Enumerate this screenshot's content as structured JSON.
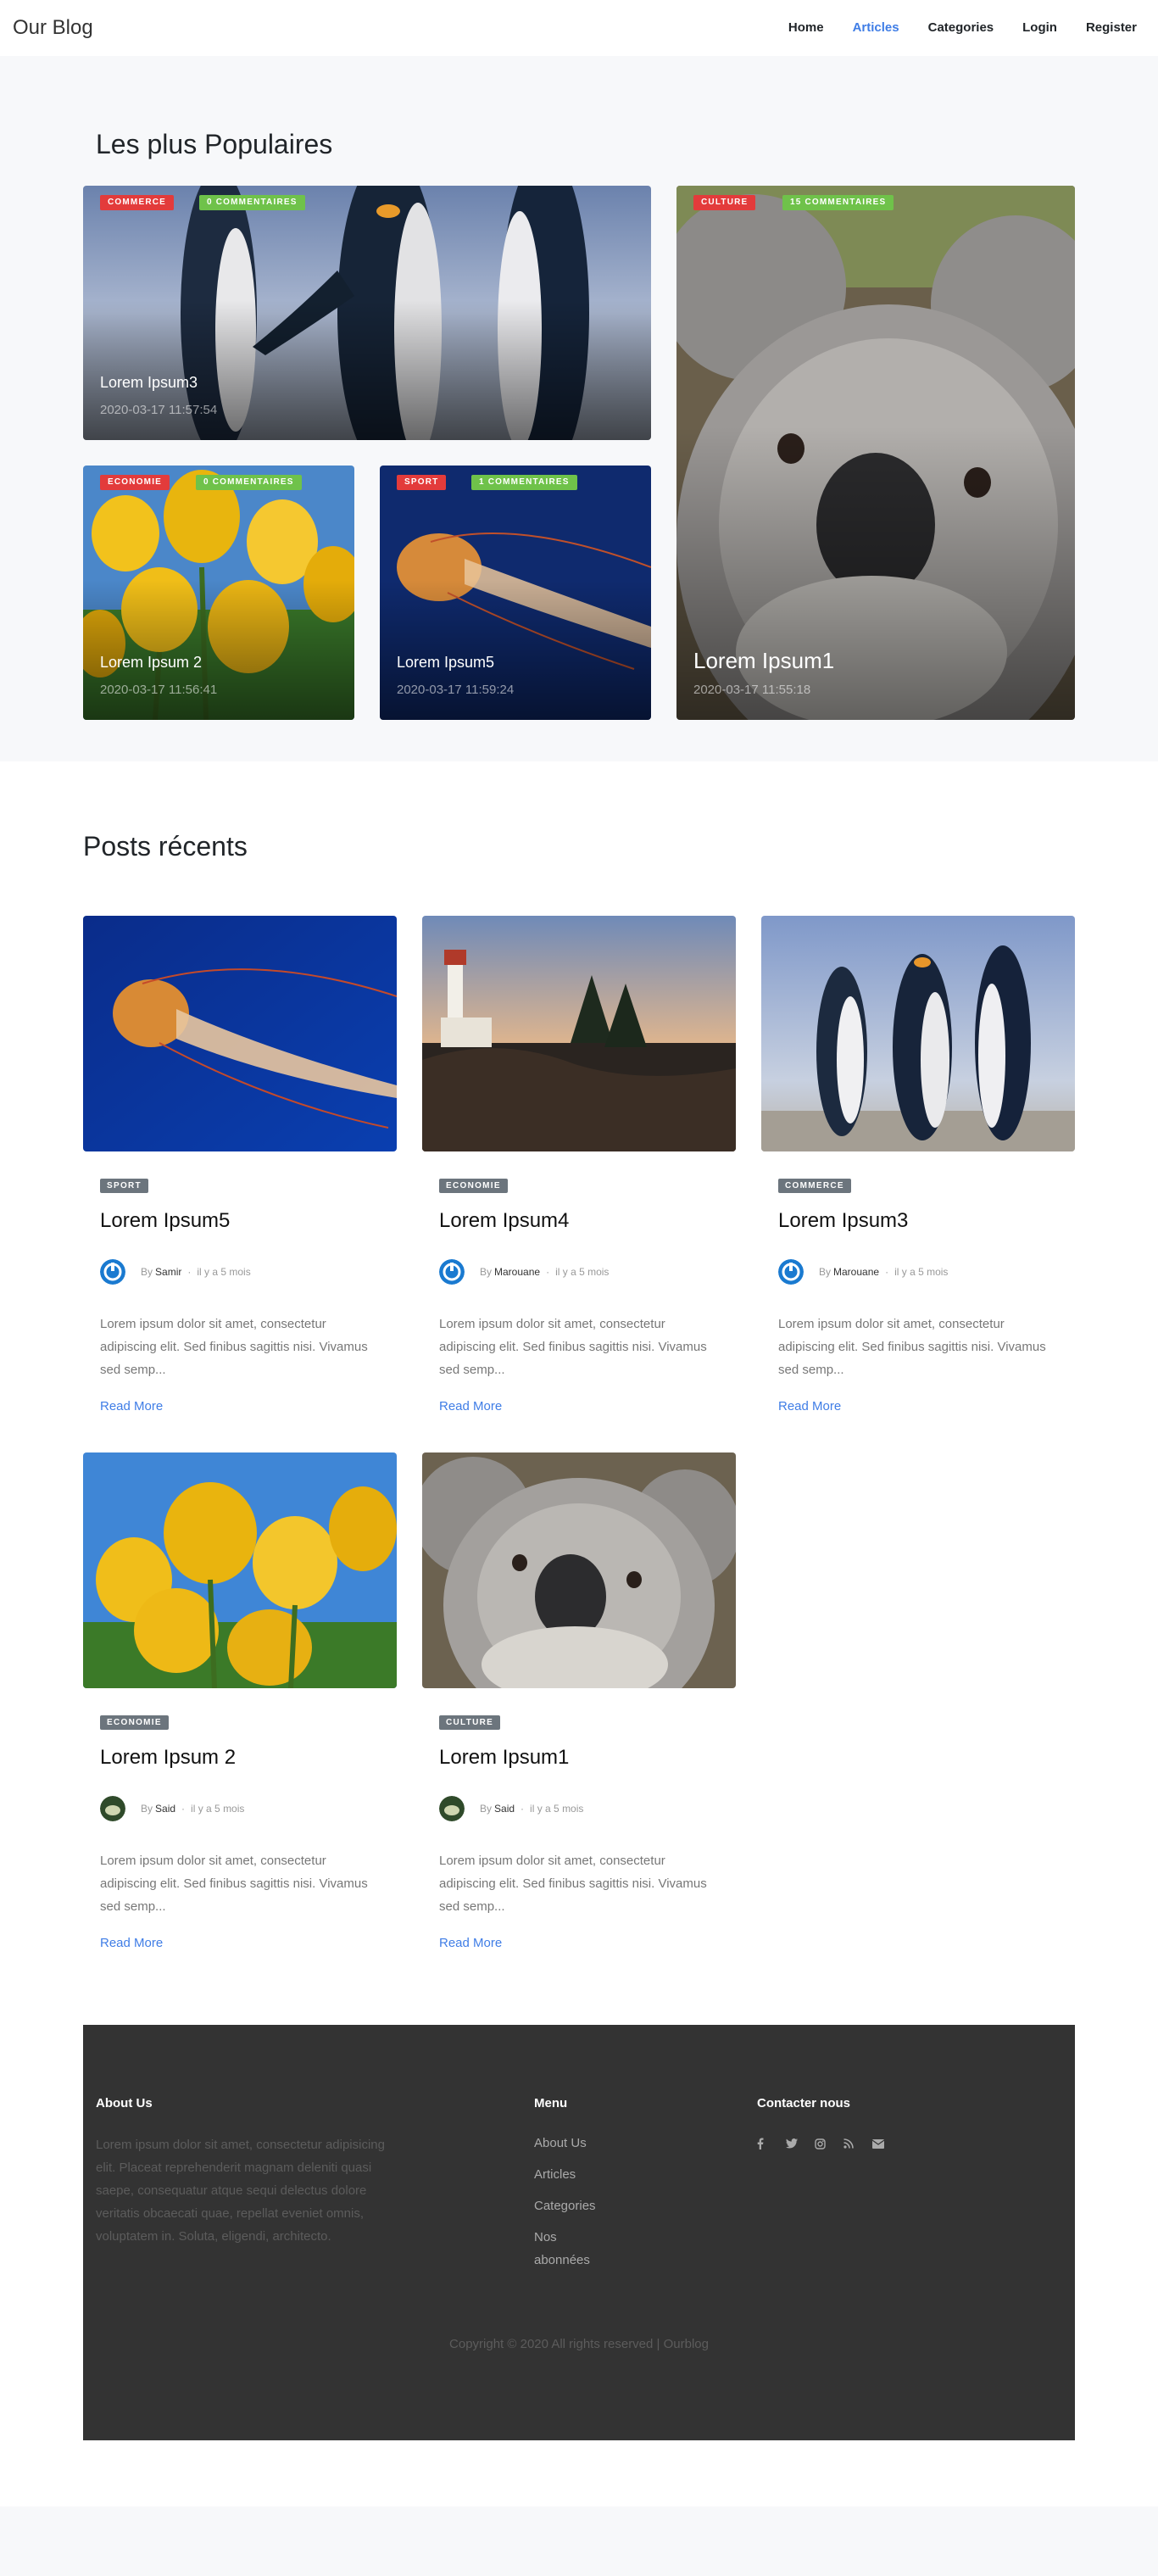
{
  "navbar": {
    "brand": "Our Blog",
    "links": [
      {
        "label": "Home",
        "active": false
      },
      {
        "label": "Articles",
        "active": true
      },
      {
        "label": "Categories",
        "active": false
      },
      {
        "label": "Login",
        "active": false
      },
      {
        "label": "Register",
        "active": false
      }
    ]
  },
  "popular": {
    "title": "Les plus Populaires",
    "cards": [
      {
        "category": "COMMERCE",
        "comments": "0 COMMENTAIRES",
        "title": "Lorem Ipsum3",
        "date": "2020-03-17 11:57:54",
        "image": "penguins"
      },
      {
        "category": "CULTURE",
        "comments": "15 COMMENTAIRES",
        "title": "Lorem Ipsum1",
        "date": "2020-03-17 11:55:18",
        "image": "koala"
      },
      {
        "category": "ECONOMIE",
        "comments": "0 COMMENTAIRES",
        "title": "Lorem Ipsum 2",
        "date": "2020-03-17 11:56:41",
        "image": "tulips"
      },
      {
        "category": "SPORT",
        "comments": "1 COMMENTAIRES",
        "title": "Lorem Ipsum5",
        "date": "2020-03-17 11:59:24",
        "image": "jellyfish"
      }
    ]
  },
  "recent": {
    "title": "Posts récents",
    "posts": [
      {
        "category": "SPORT",
        "title": "Lorem Ipsum5",
        "by": "By",
        "author": "Samir",
        "time": "il y a 5 mois",
        "excerpt": "Lorem ipsum dolor sit amet, consectetur adipiscing elit. Sed finibus sagittis nisi. Vivamus sed semp...",
        "read_more": "Read More",
        "image": "jellyfish",
        "avatar": "power-avatar"
      },
      {
        "category": "ECONOMIE",
        "title": "Lorem Ipsum4",
        "by": "By",
        "author": "Marouane",
        "time": "il y a 5 mois",
        "excerpt": "Lorem ipsum dolor sit amet, consectetur adipiscing elit. Sed finibus sagittis nisi. Vivamus sed semp...",
        "read_more": "Read More",
        "image": "lighthouse",
        "avatar": "power-avatar"
      },
      {
        "category": "COMMERCE",
        "title": "Lorem Ipsum3",
        "by": "By",
        "author": "Marouane",
        "time": "il y a 5 mois",
        "excerpt": "Lorem ipsum dolor sit amet, consectetur adipiscing elit. Sed finibus sagittis nisi. Vivamus sed semp...",
        "read_more": "Read More",
        "image": "penguins",
        "avatar": "power-avatar"
      },
      {
        "category": "ECONOMIE",
        "title": "Lorem Ipsum 2",
        "by": "By",
        "author": "Said",
        "time": "il y a 5 mois",
        "excerpt": "Lorem ipsum dolor sit amet, consectetur adipiscing elit. Sed finibus sagittis nisi. Vivamus sed semp...",
        "read_more": "Read More",
        "image": "tulips",
        "avatar": "photo-avatar"
      },
      {
        "category": "CULTURE",
        "title": "Lorem Ipsum1",
        "by": "By",
        "author": "Said",
        "time": "il y a 5 mois",
        "excerpt": "Lorem ipsum dolor sit amet, consectetur adipiscing elit. Sed finibus sagittis nisi. Vivamus sed semp...",
        "read_more": "Read More",
        "image": "koala",
        "avatar": "photo-avatar"
      }
    ]
  },
  "footer": {
    "about_title": "About Us",
    "about_text": "Lorem ipsum dolor sit amet, consectetur adipisicing elit. Placeat reprehenderit magnam deleniti quasi saepe, consequatur atque sequi delectus dolore veritatis obcaecati quae, repellat eveniet omnis, voluptatem in. Soluta, eligendi, architecto.",
    "menu_title": "Menu",
    "menu_items": [
      "About Us",
      "Articles",
      "Categories",
      "Nos abonnées"
    ],
    "contact_title": "Contacter nous",
    "social_icons": [
      "facebook-icon",
      "twitter-icon",
      "instagram-icon",
      "rss-icon",
      "envelope-icon"
    ],
    "copyright": "Copyright © 2020 All rights reserved | Ourblog"
  },
  "colors": {
    "accent": "#3f7de6",
    "category_pill": "#e33b3b",
    "comments_pill": "#6fc24a",
    "badge": "#6c757d",
    "footer_bg": "#333333"
  }
}
